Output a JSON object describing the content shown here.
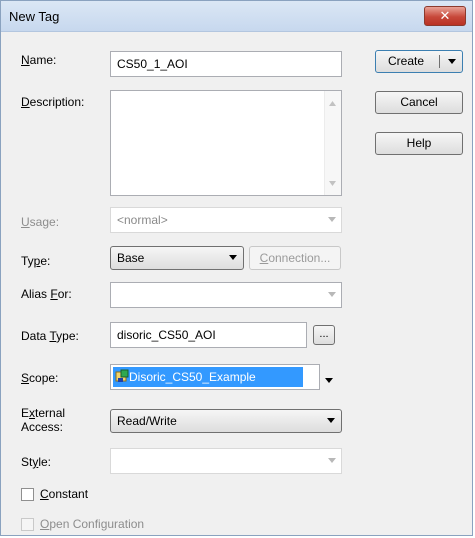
{
  "window": {
    "title": "New Tag",
    "close_glyph": "✕"
  },
  "labels": {
    "name": {
      "pre": "",
      "u": "N",
      "post": "ame:"
    },
    "description": {
      "pre": "",
      "u": "D",
      "post": "escription:"
    },
    "usage": {
      "pre": "",
      "u": "U",
      "post": "sage:"
    },
    "type": {
      "pre": "Ty",
      "u": "p",
      "post": "e:"
    },
    "alias_for": {
      "pre": "Alias ",
      "u": "F",
      "post": "or:"
    },
    "data_type": {
      "pre": "Data ",
      "u": "T",
      "post": "ype:"
    },
    "scope": {
      "pre": "",
      "u": "S",
      "post": "cope:"
    },
    "external_access_line1": {
      "pre": "E",
      "u": "x",
      "post": "ternal"
    },
    "external_access_line2": "Access:",
    "style": {
      "pre": "St",
      "u": "y",
      "post": "le:"
    },
    "constant": {
      "pre": "",
      "u": "C",
      "post": "onstant"
    },
    "open_configuration": {
      "pre": "",
      "u": "O",
      "post": "pen Configuration"
    }
  },
  "fields": {
    "name_value": "CS50_1_AOI",
    "description_value": "",
    "usage_value": "<normal>",
    "type_value": "Base",
    "alias_for_value": "",
    "data_type_value": "disoric_CS50_AOI",
    "scope_value": "Disoric_CS50_Example",
    "external_access_value": "Read/Write",
    "style_value": ""
  },
  "buttons": {
    "create": "Create",
    "cancel": "Cancel",
    "help": "Help",
    "connection": {
      "pre": "",
      "u": "C",
      "post": "onnection..."
    },
    "browse": "..."
  },
  "checkboxes": {
    "constant": false,
    "open_configuration": false
  },
  "colors": {
    "selection": "#3399ff",
    "titlebar": "#c7d8ee",
    "close": "#c7483a"
  }
}
